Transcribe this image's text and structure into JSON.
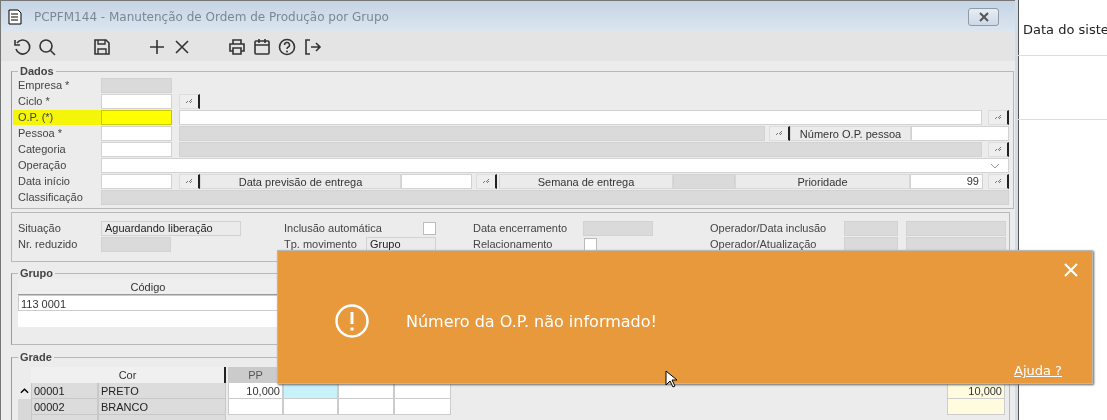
{
  "window": {
    "title": "PCPFM144 - Manutenção de Ordem de Produção por Grupo"
  },
  "toolbar": [
    {
      "kind": "undo"
    },
    {
      "kind": "search"
    },
    {
      "kind": "gap"
    },
    {
      "kind": "save"
    },
    {
      "kind": "gap"
    },
    {
      "kind": "add"
    },
    {
      "kind": "delete"
    },
    {
      "kind": "gap"
    },
    {
      "kind": "print"
    },
    {
      "kind": "calendar"
    },
    {
      "kind": "help"
    },
    {
      "kind": "exit"
    }
  ],
  "dados": {
    "legend": "Dados",
    "empresa": {
      "label": "Empresa *"
    },
    "ciclo": {
      "label": "Ciclo *"
    },
    "op": {
      "label": "O.P. (*)",
      "highlighted": true
    },
    "pessoa": {
      "label": "Pessoa *",
      "numero_label": "Número O.P. pessoa"
    },
    "categoria": {
      "label": "Categoria"
    },
    "operacao": {
      "label": "Operação"
    },
    "data_inicio": {
      "label": "Data início",
      "previsao_label": "Data previsão de entrega",
      "semana_label": "Semana de entrega",
      "prioridade_label": "Prioridade",
      "prioridade_value": "99"
    },
    "classificacao": {
      "label": "Classificação"
    }
  },
  "status": {
    "situacao": {
      "label": "Situação",
      "value": "Aguardando liberação"
    },
    "nr_reduzido": {
      "label": "Nr. reduzido"
    },
    "inclusao_automatica": {
      "label": "Inclusão automática",
      "checked": false
    },
    "tp_movimento": {
      "label": "Tp. movimento",
      "value": "Grupo"
    },
    "data_encerramento": {
      "label": "Data encerramento"
    },
    "relacionamento": {
      "label": "Relacionamento",
      "checked": false
    },
    "operador_inclusao": {
      "label": "Operador/Data inclusão"
    },
    "operador_atualizacao": {
      "label": "Operador/Atualização"
    }
  },
  "grupo": {
    "legend": "Grupo",
    "column": "Código",
    "rows": [
      "113 0001"
    ]
  },
  "grade": {
    "legend": "Grade",
    "columns": [
      "Cor",
      "PP"
    ],
    "rows": [
      {
        "code": "00001",
        "cor": "PRETO",
        "pp": "10,000",
        "last": "10,000",
        "selected": true
      },
      {
        "code": "00002",
        "cor": "BRANCO",
        "pp": "",
        "last": "",
        "selected": false
      }
    ]
  },
  "toast": {
    "message": "Número da O.P. não informado!",
    "help_link": "Ajuda ?"
  },
  "background": {
    "text": "Data do siste"
  }
}
